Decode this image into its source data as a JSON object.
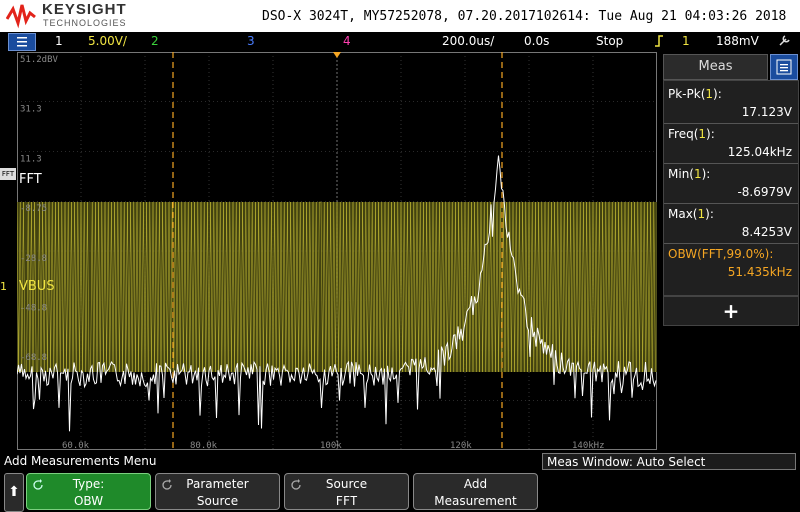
{
  "header": {
    "brand": "KEYSIGHT",
    "brand_sub": "TECHNOLOGIES",
    "title": "DSO-X 3024T, MY57252078, 07.20.2017102614: Tue Aug 21 04:03:26 2018"
  },
  "status": {
    "ch1": "1",
    "ch1_scale": "5.00V/",
    "ch2": "2",
    "ch3": "3",
    "ch4": "4",
    "timebase": "200.0us/",
    "delay": "0.0s",
    "run_state": "Stop",
    "trigger_ch": "1",
    "trigger_level": "188mV"
  },
  "graticule": {
    "y_labels": [
      "51.2dBV",
      "31.3",
      "11.3",
      "-8.75",
      "-28.8",
      "-48.8",
      "-68.8"
    ],
    "x_labels": [
      "60.0k",
      "80.0k",
      "100k",
      "120k",
      "140kHz"
    ],
    "fft_label": "FFT",
    "vbus_label": "VBUS",
    "fft_marker": "FFT",
    "ch_marker": "1"
  },
  "meas_panel": {
    "tab_label": "Meas",
    "measurements": [
      {
        "label_pre": "Pk-Pk(",
        "label_ch": "1",
        "label_post": "):",
        "value": "17.123V"
      },
      {
        "label_pre": "Freq(",
        "label_ch": "1",
        "label_post": "):",
        "value": "125.04kHz"
      },
      {
        "label_pre": "Min(",
        "label_ch": "1",
        "label_post": "):",
        "value": "-8.6979V"
      },
      {
        "label_pre": "Max(",
        "label_ch": "1",
        "label_post": "):",
        "value": "8.4253V"
      },
      {
        "label_pre": "OBW(FFT,99.0%):",
        "label_ch": "",
        "label_post": "",
        "value": "51.435kHz"
      }
    ],
    "add_symbol": "+"
  },
  "softkeys": {
    "menu_title": "Add Measurements Menu",
    "meas_window": "Meas Window: Auto Select",
    "up_arrow": "⬆",
    "keys": [
      {
        "line1": "Type:",
        "line2": "OBW"
      },
      {
        "line1": "Parameter",
        "line2": "Source"
      },
      {
        "line1": "Source",
        "line2": "FFT"
      },
      {
        "line1": "Add",
        "line2": "Measurement"
      }
    ]
  },
  "colors": {
    "ch1": "#f0e442",
    "ch2": "#3cd23c",
    "ch3": "#4a7dff",
    "ch4": "#ff3fb0",
    "fft": "#ffffff",
    "cursor": "#f5a623",
    "accent": "#1a4c9e"
  }
}
